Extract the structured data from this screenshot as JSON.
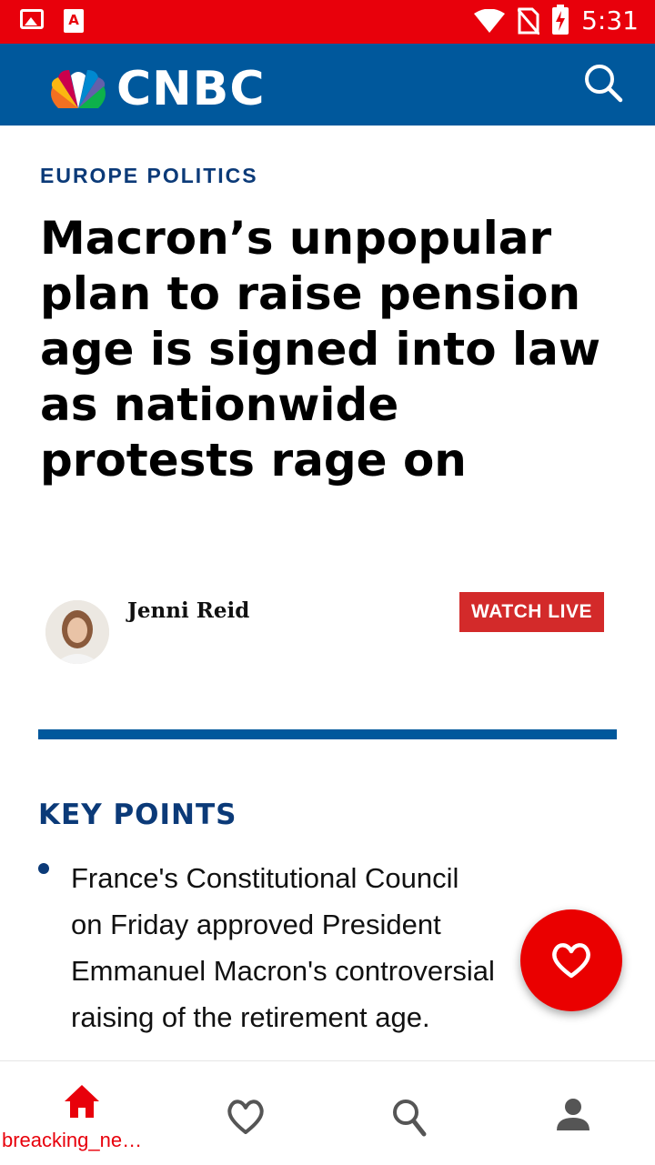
{
  "status_bar": {
    "time": "5:31",
    "icons_left": [
      "image-icon",
      "app-a-icon"
    ],
    "icons_right": [
      "wifi-icon",
      "no-sim-icon",
      "battery-charging-icon"
    ]
  },
  "app_bar": {
    "logo_text": "CNBC",
    "logo_icon": "peacock-icon",
    "search_icon": "search-icon",
    "color": "#00589c"
  },
  "article": {
    "section": "EUROPE POLITICS",
    "headline": "Macron’s unpopular plan to raise pension age is signed into law as nationwide protests rage on",
    "author": "Jenni Reid",
    "watch_live_label": "WATCH LIVE",
    "key_points_title": "KEY POINTS",
    "key_points": [
      {
        "lines": [
          "France's Constitutional Council",
          "on Friday approved President",
          "Emmanuel Macron's controversial",
          "raising of the retirement age."
        ]
      }
    ]
  },
  "fab": {
    "icon": "heart-icon",
    "color": "#ea0000"
  },
  "bottom_nav": {
    "items": [
      {
        "icon": "home-icon",
        "label": "breacking_ne…",
        "active": true
      },
      {
        "icon": "heart-outline-icon",
        "label": "",
        "active": false
      },
      {
        "icon": "search-icon",
        "label": "",
        "active": false
      },
      {
        "icon": "person-icon",
        "label": "",
        "active": false
      }
    ],
    "active_color": "#e8000b"
  }
}
